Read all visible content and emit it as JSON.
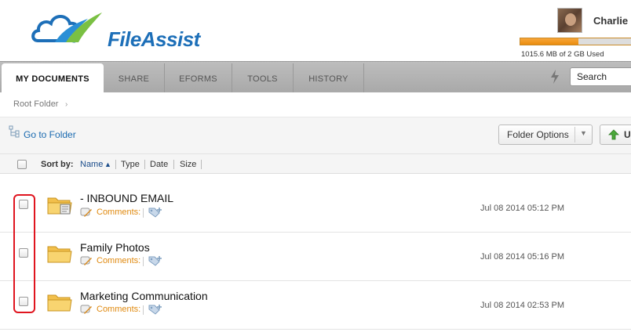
{
  "brand": {
    "name": "FileAssist"
  },
  "user": {
    "name": "Charlie",
    "usage_text": "1015.6 MB of 2 GB Used",
    "usage_fraction": 0.5
  },
  "tabs": [
    {
      "label": "MY DOCUMENTS",
      "active": true
    },
    {
      "label": "SHARE",
      "active": false
    },
    {
      "label": "EFORMS",
      "active": false
    },
    {
      "label": "TOOLS",
      "active": false
    },
    {
      "label": "HISTORY",
      "active": false
    }
  ],
  "search": {
    "value": "Search"
  },
  "breadcrumb": {
    "root": "Root Folder"
  },
  "toolbar": {
    "goto_label": "Go to Folder",
    "folder_options_label": "Folder Options",
    "upload_label": "U"
  },
  "sortbar": {
    "label": "Sort by:",
    "options": [
      "Name",
      "Type",
      "Date",
      "Size"
    ],
    "active": "Name"
  },
  "files": [
    {
      "name": "- INBOUND EMAIL",
      "comments_label": "Comments:",
      "date": "Jul 08 2014 05:12 PM",
      "icon": "inbox-folder-icon"
    },
    {
      "name": "Family Photos",
      "comments_label": "Comments:",
      "date": "Jul 08 2014 05:16 PM",
      "icon": "folder-icon"
    },
    {
      "name": "Marketing Communication",
      "comments_label": "Comments:",
      "date": "Jul 08 2014 02:53 PM",
      "icon": "folder-icon"
    }
  ],
  "colors": {
    "brand_blue": "#1d6fb8",
    "usage_orange": "#f29a1e",
    "highlight_red": "#e0151f",
    "link_orange": "#e08a10"
  }
}
